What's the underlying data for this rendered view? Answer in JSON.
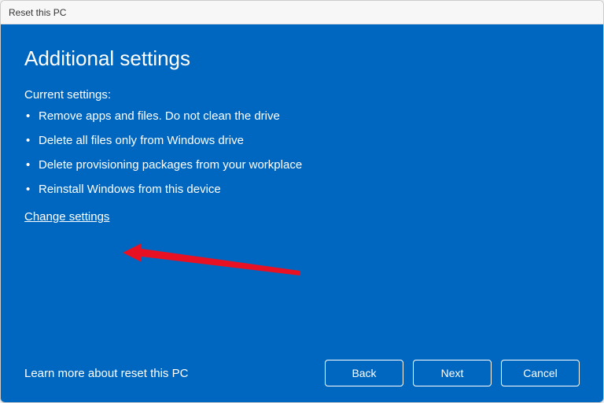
{
  "window": {
    "title": "Reset this PC"
  },
  "page": {
    "heading": "Additional settings",
    "subtitle": "Current settings:",
    "settings": [
      "Remove apps and files. Do not clean the drive",
      "Delete all files only from Windows drive",
      "Delete provisioning packages from your workplace",
      "Reinstall Windows from this device"
    ],
    "change_link": "Change settings",
    "learn_more": "Learn more about reset this PC"
  },
  "buttons": {
    "back": "Back",
    "next": "Next",
    "cancel": "Cancel"
  },
  "colors": {
    "accent": "#0067C0",
    "arrow": "#E81123"
  }
}
